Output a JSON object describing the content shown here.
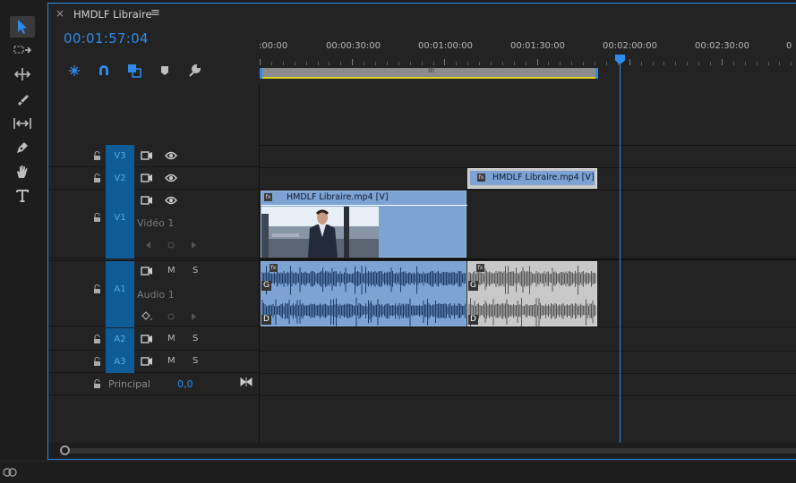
{
  "tab": {
    "close": "×",
    "title": "HMDLF Libraire",
    "menu": "≡"
  },
  "timecode": "00:01:57:04",
  "toolbar_icons": [
    "snap-icon",
    "magnet-icon",
    "linked-selection-icon",
    "marker-icon",
    "wrench-icon"
  ],
  "tools": [
    "selection-tool-icon",
    "track-select-icon",
    "ripple-edit-icon",
    "razor-icon",
    "slip-icon",
    "pen-icon",
    "hand-icon",
    "type-icon"
  ],
  "ruler": {
    "labels": [
      ":00:00",
      "00:00:30:00",
      "00:01:00:00",
      "00:01:30:00",
      "00:02:00:00",
      "00:02:30:00",
      "0"
    ],
    "workarea_grip": "III"
  },
  "tracks": {
    "v3": {
      "target": "V3"
    },
    "v2": {
      "target": "V2"
    },
    "v1": {
      "target": "V1",
      "name": "Vidéo 1"
    },
    "a1": {
      "target": "A1",
      "name": "Audio 1",
      "m": "M",
      "s": "S"
    },
    "a2": {
      "target": "A2",
      "m": "M",
      "s": "S"
    },
    "a3": {
      "target": "A3",
      "m": "M",
      "s": "S"
    },
    "master": {
      "name": "Principal",
      "value": "0,0"
    }
  },
  "clips": {
    "v2_clip": "HMDLF Libraire.mp4 [V]",
    "v1_clip": "HMDLF Libraire.mp4 [V]",
    "fx": "fx",
    "channel_g": "G",
    "channel_d": "D"
  },
  "colors": {
    "accent": "#2d8ceb",
    "target_bg": "#0f5c96",
    "clip_blue": "#7da2d4",
    "clip_gray": "#c8c8c8",
    "workarea_line": "#e1d21f"
  }
}
